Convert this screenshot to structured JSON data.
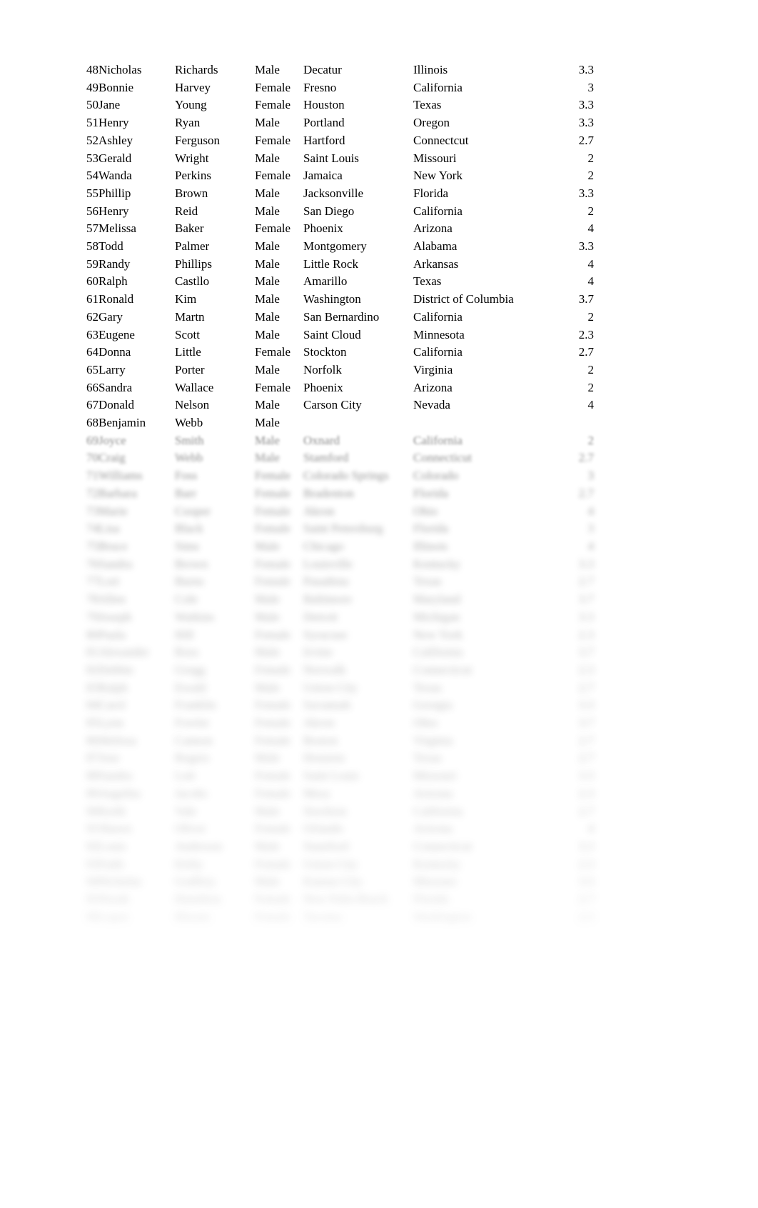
{
  "document": {
    "type": "spreadsheet-data-table",
    "background_color": "#ffffff",
    "text_color": "#000000",
    "blurred_text_color": "#6f6f6f",
    "columns": [
      "index",
      "first_name",
      "last_name",
      "gender",
      "city",
      "state",
      "score"
    ],
    "visible_row_range": "48-68 sharp, remainder blurred/illegible"
  },
  "rows": [
    {
      "index": "48",
      "first_name": "Nicholas",
      "last_name": "Richards",
      "gender": "Male",
      "city": "Decatur",
      "state": "Illinois",
      "score": "3.3"
    },
    {
      "index": "49",
      "first_name": "Bonnie",
      "last_name": "Harvey",
      "gender": "Female",
      "city": "Fresno",
      "state": "California",
      "score": "3"
    },
    {
      "index": "50",
      "first_name": "Jane",
      "last_name": "Young",
      "gender": "Female",
      "city": "Houston",
      "state": "Texas",
      "score": "3.3"
    },
    {
      "index": "51",
      "first_name": "Henry",
      "last_name": "Ryan",
      "gender": "Male",
      "city": "Portland",
      "state": "Oregon",
      "score": "3.3"
    },
    {
      "index": "52",
      "first_name": "Ashley",
      "last_name": "Ferguson",
      "gender": "Female",
      "city": "Hartford",
      "state": "Connectcut",
      "score": "2.7"
    },
    {
      "index": "53",
      "first_name": "Gerald",
      "last_name": "Wright",
      "gender": "Male",
      "city": "Saint Louis",
      "state": "Missouri",
      "score": "2"
    },
    {
      "index": "54",
      "first_name": "Wanda",
      "last_name": "Perkins",
      "gender": "Female",
      "city": "Jamaica",
      "state": "New York",
      "score": "2"
    },
    {
      "index": "55",
      "first_name": "Phillip",
      "last_name": "Brown",
      "gender": "Male",
      "city": "Jacksonville",
      "state": "Florida",
      "score": "3.3"
    },
    {
      "index": "56",
      "first_name": "Henry",
      "last_name": "Reid",
      "gender": "Male",
      "city": "San Diego",
      "state": "California",
      "score": "2"
    },
    {
      "index": "57",
      "first_name": "Melissa",
      "last_name": "Baker",
      "gender": "Female",
      "city": "Phoenix",
      "state": "Arizona",
      "score": "4"
    },
    {
      "index": "58",
      "first_name": "Todd",
      "last_name": "Palmer",
      "gender": "Male",
      "city": "Montgomery",
      "state": "Alabama",
      "score": "3.3"
    },
    {
      "index": "59",
      "first_name": "Randy",
      "last_name": "Phillips",
      "gender": "Male",
      "city": "Little Rock",
      "state": "Arkansas",
      "score": "4"
    },
    {
      "index": "60",
      "first_name": "Ralph",
      "last_name": "Castllo",
      "gender": "Male",
      "city": "Amarillo",
      "state": "Texas",
      "score": "4"
    },
    {
      "index": "61",
      "first_name": "Ronald",
      "last_name": "Kim",
      "gender": "Male",
      "city": "Washington",
      "state": "District of Columbia",
      "score": "3.7"
    },
    {
      "index": "62",
      "first_name": "Gary",
      "last_name": "Martn",
      "gender": "Male",
      "city": "San Bernardino",
      "state": "California",
      "score": "2"
    },
    {
      "index": "63",
      "first_name": "Eugene",
      "last_name": "Scott",
      "gender": "Male",
      "city": "Saint Cloud",
      "state": "Minnesota",
      "score": "2.3"
    },
    {
      "index": "64",
      "first_name": "Donna",
      "last_name": "Little",
      "gender": "Female",
      "city": "Stockton",
      "state": "California",
      "score": "2.7"
    },
    {
      "index": "65",
      "first_name": "Larry",
      "last_name": "Porter",
      "gender": "Male",
      "city": "Norfolk",
      "state": "Virginia",
      "score": "2"
    },
    {
      "index": "66",
      "first_name": "Sandra",
      "last_name": "Wallace",
      "gender": "Female",
      "city": "Phoenix",
      "state": "Arizona",
      "score": "2"
    },
    {
      "index": "67",
      "first_name": "Donald",
      "last_name": "Nelson",
      "gender": "Male",
      "city": "Carson City",
      "state": "Nevada",
      "score": "4"
    },
    {
      "index": "68",
      "first_name": "Benjamin",
      "last_name": "Webb",
      "gender": "Male",
      "city": "",
      "state": "",
      "score": ""
    }
  ],
  "blurred_rows": [
    {
      "index": "69",
      "first_name": "Joyce",
      "last_name": "Smith",
      "gender": "Male",
      "city": "Oxnard",
      "state": "California",
      "score": "2"
    },
    {
      "index": "70",
      "first_name": "Craig",
      "last_name": "Webb",
      "gender": "Male",
      "city": "Stamford",
      "state": "Connecticut",
      "score": "2.7"
    },
    {
      "index": "71",
      "first_name": "Williams",
      "last_name": "Foss",
      "gender": "Female",
      "city": "Colorado Springs",
      "state": "Colorado",
      "score": "3"
    },
    {
      "index": "72",
      "first_name": "Barbara",
      "last_name": "Barr",
      "gender": "Female",
      "city": "Bradenton",
      "state": "Florida",
      "score": "2.7"
    },
    {
      "index": "73",
      "first_name": "Marie",
      "last_name": "Cooper",
      "gender": "Female",
      "city": "Akron",
      "state": "Ohio",
      "score": "4"
    },
    {
      "index": "74",
      "first_name": "Lisa",
      "last_name": "Black",
      "gender": "Female",
      "city": "Saint Petersburg",
      "state": "Florida",
      "score": "3"
    },
    {
      "index": "75",
      "first_name": "Bruce",
      "last_name": "Sims",
      "gender": "Male",
      "city": "Chicago",
      "state": "Illinois",
      "score": "4"
    },
    {
      "index": "76",
      "first_name": "Sandra",
      "last_name": "Brown",
      "gender": "Female",
      "city": "Louisville",
      "state": "Kentucky",
      "score": "3.3"
    },
    {
      "index": "77",
      "first_name": "Lori",
      "last_name": "Burns",
      "gender": "Female",
      "city": "Pasadena",
      "state": "Texas",
      "score": "2.7"
    },
    {
      "index": "78",
      "first_name": "Allen",
      "last_name": "Cole",
      "gender": "Male",
      "city": "Baltimore",
      "state": "Maryland",
      "score": "3.7"
    },
    {
      "index": "79",
      "first_name": "Joseph",
      "last_name": "Watkins",
      "gender": "Male",
      "city": "Detroit",
      "state": "Michigan",
      "score": "3.3"
    },
    {
      "index": "80",
      "first_name": "Paula",
      "last_name": "Hill",
      "gender": "Female",
      "city": "Syracuse",
      "state": "New York",
      "score": "2.3"
    },
    {
      "index": "81",
      "first_name": "Alexander",
      "last_name": "Ross",
      "gender": "Male",
      "city": "Irvine",
      "state": "California",
      "score": "3.7"
    },
    {
      "index": "82",
      "first_name": "Debbie",
      "last_name": "Gregg",
      "gender": "Female",
      "city": "Norwalk",
      "state": "Connecticut",
      "score": "2.3"
    },
    {
      "index": "83",
      "first_name": "Ralph",
      "last_name": "Ewald",
      "gender": "Male",
      "city": "Union City",
      "state": "Texas",
      "score": "2.7"
    },
    {
      "index": "84",
      "first_name": "Carol",
      "last_name": "Franklin",
      "gender": "Female",
      "city": "Savannah",
      "state": "Georgia",
      "score": "3.3"
    },
    {
      "index": "85",
      "first_name": "Lynn",
      "last_name": "Fowler",
      "gender": "Female",
      "city": "Akron",
      "state": "Ohio",
      "score": "3.7"
    },
    {
      "index": "86",
      "first_name": "Melissa",
      "last_name": "Cannon",
      "gender": "Female",
      "city": "Boston",
      "state": "Virginia",
      "score": "2.7"
    },
    {
      "index": "87",
      "first_name": "Jose",
      "last_name": "Rogers",
      "gender": "Male",
      "city": "Houston",
      "state": "Texas",
      "score": "2.7"
    },
    {
      "index": "88",
      "first_name": "Sandra",
      "last_name": "Lott",
      "gender": "Female",
      "city": "Saint Louis",
      "state": "Missouri",
      "score": "3.3"
    },
    {
      "index": "89",
      "first_name": "Angelita",
      "last_name": "Jacobs",
      "gender": "Female",
      "city": "Mesa",
      "state": "Arizona",
      "score": "2.3"
    },
    {
      "index": "90",
      "first_name": "Keith",
      "last_name": "Vale",
      "gender": "Male",
      "city": "Stockton",
      "state": "California",
      "score": "2.7"
    },
    {
      "index": "91",
      "first_name": "Shawn",
      "last_name": "Oliver",
      "gender": "Female",
      "city": "Orlando",
      "state": "Arizona",
      "score": "4"
    },
    {
      "index": "92",
      "first_name": "Louis",
      "last_name": "Anderson",
      "gender": "Male",
      "city": "Stamford",
      "state": "Connecticut",
      "score": "3.3"
    },
    {
      "index": "93",
      "first_name": "Faith",
      "last_name": "Kirby",
      "gender": "Female",
      "city": "Union City",
      "state": "Kentucky",
      "score": "2.3"
    },
    {
      "index": "94",
      "first_name": "Nicholas",
      "last_name": "Godfrey",
      "gender": "Male",
      "city": "Kansas City",
      "state": "Missouri",
      "score": "3.3"
    },
    {
      "index": "95",
      "first_name": "Norah",
      "last_name": "Hamilton",
      "gender": "Female",
      "city": "New Palm Beach",
      "state": "Florida",
      "score": "2.7"
    },
    {
      "index": "96",
      "first_name": "Lopez",
      "last_name": "Rhoem",
      "gender": "Female",
      "city": "Tacoma",
      "state": "Washington",
      "score": "2.3"
    }
  ]
}
